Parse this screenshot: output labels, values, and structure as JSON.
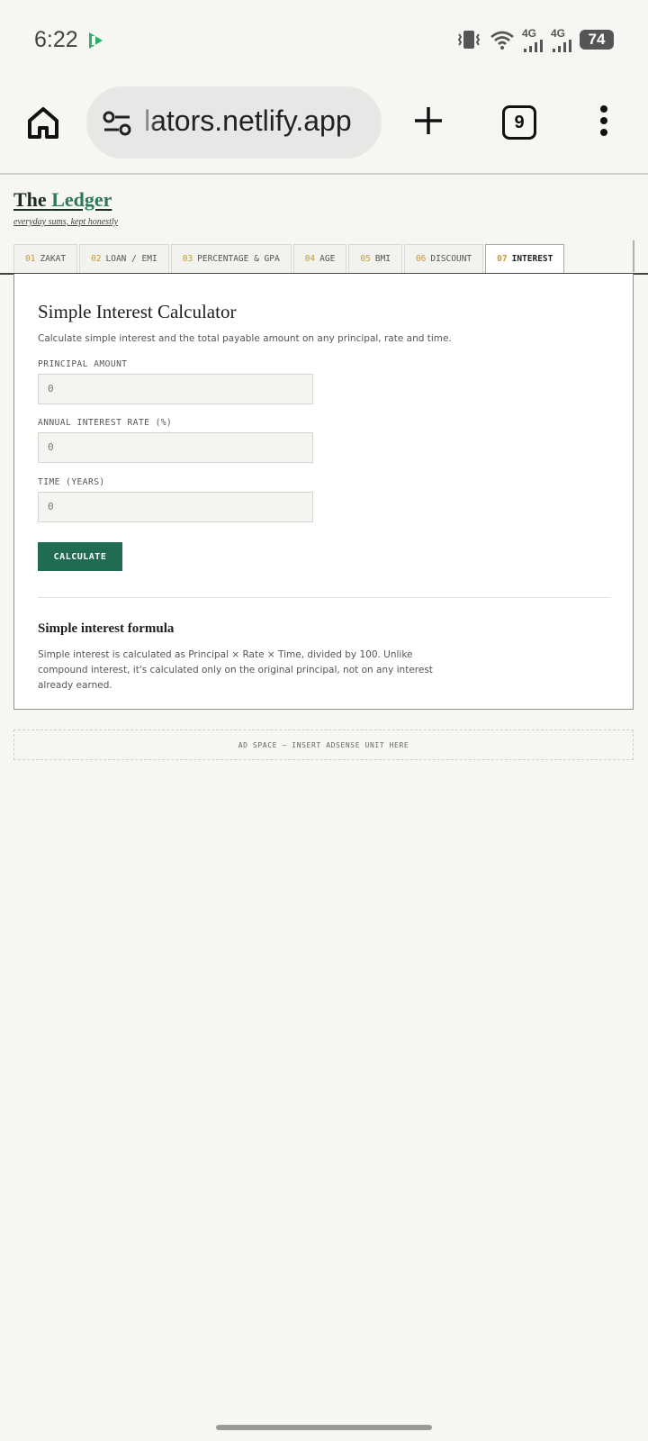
{
  "status": {
    "time": "6:22",
    "network_1": "4G",
    "network_2": "4G",
    "battery": "74"
  },
  "browser": {
    "url": "lators.netlify.app",
    "tab_count": "9"
  },
  "site": {
    "title_part1": "The ",
    "title_part2": "Ledger",
    "tagline": "everyday sums, kept honestly"
  },
  "tabs": [
    {
      "num": "01",
      "label": "ZAKAT"
    },
    {
      "num": "02",
      "label": "LOAN / EMI"
    },
    {
      "num": "03",
      "label": "PERCENTAGE & GPA"
    },
    {
      "num": "04",
      "label": "AGE"
    },
    {
      "num": "05",
      "label": "BMI"
    },
    {
      "num": "06",
      "label": "DISCOUNT"
    },
    {
      "num": "07",
      "label": "INTEREST"
    }
  ],
  "active_tab_index": 6,
  "calculator": {
    "title": "Simple Interest Calculator",
    "description": "Calculate simple interest and the total payable amount on any principal, rate and time.",
    "fields": [
      {
        "label": "PRINCIPAL AMOUNT",
        "placeholder": "0"
      },
      {
        "label": "ANNUAL INTEREST RATE (%)",
        "placeholder": "0"
      },
      {
        "label": "TIME (YEARS)",
        "placeholder": "0"
      }
    ],
    "button_label": "CALCULATE"
  },
  "formula": {
    "title": "Simple interest formula",
    "text": "Simple interest is calculated as Principal × Rate × Time, divided by 100. Unlike compound interest, it's calculated only on the original principal, not on any interest already earned."
  },
  "ad": {
    "text": "AD SPACE — INSERT ADSENSE UNIT HERE"
  },
  "colors": {
    "accent": "#1f6b54",
    "tab_number": "#c79a3b",
    "background": "#f6f6f2"
  }
}
